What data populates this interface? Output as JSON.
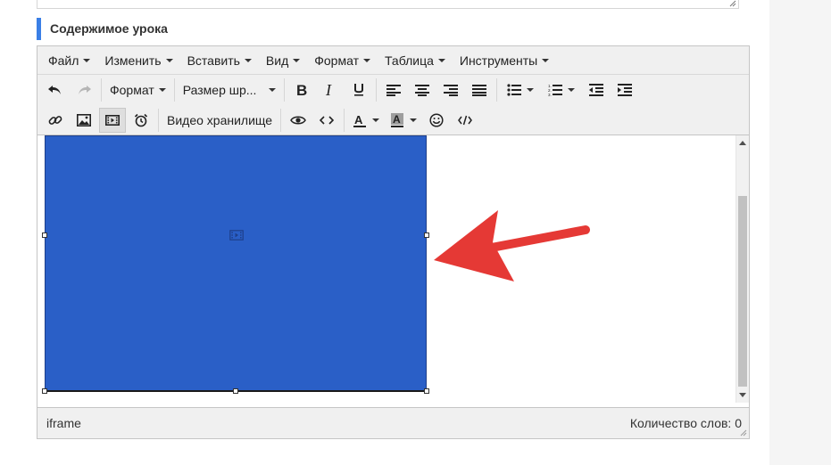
{
  "section_title": "Содержимое урока",
  "menubar": {
    "items": [
      "Файл",
      "Изменить",
      "Вставить",
      "Вид",
      "Формат",
      "Таблица",
      "Инструменты"
    ]
  },
  "toolbar": {
    "format_label": "Формат",
    "font_size_label": "Размер шр...",
    "video_storage_label": "Видео хранилище"
  },
  "status": {
    "element_path": "iframe",
    "word_count": "Количество слов: 0"
  },
  "colors": {
    "video_block": "#2a5fc7",
    "annotation_arrow": "#e53935",
    "section_accent": "#3a7fe6"
  }
}
